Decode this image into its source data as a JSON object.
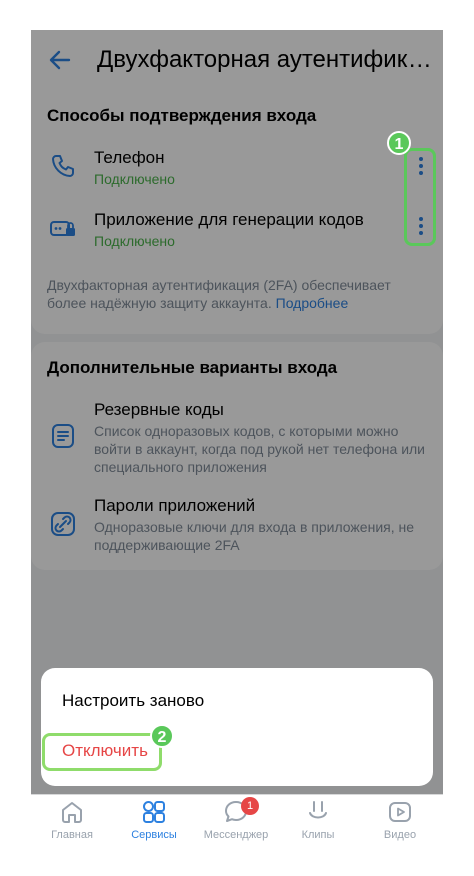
{
  "header": {
    "title": "Двухфакторная аутентификация"
  },
  "confirm_methods": {
    "title": "Способы подтверждения входа",
    "items": [
      {
        "title": "Телефон",
        "status": "Подключено"
      },
      {
        "title": "Приложение для генерации кодов",
        "status": "Подключено"
      }
    ],
    "info_text": "Двухфакторная аутентификация (2FA) обеспечивает более надёжную защиту аккаунта.",
    "info_link": "Подробнее"
  },
  "extra_methods": {
    "title": "Дополнительные варианты входа",
    "items": [
      {
        "title": "Резервные коды",
        "desc": "Список одноразовых кодов, с которыми можно войти в аккаунт, когда под рукой нет телефона или специального приложения"
      },
      {
        "title": "Пароли приложений",
        "desc": "Одноразовые ключи для входа в приложения, не поддерживающие 2FA"
      }
    ]
  },
  "sheet": {
    "reset_label": "Настроить заново",
    "disable_label": "Отключить"
  },
  "badges": {
    "one": "1",
    "two": "2"
  },
  "tabbar": {
    "tabs": [
      {
        "label": "Главная"
      },
      {
        "label": "Сервисы"
      },
      {
        "label": "Мессенджер",
        "count": "1"
      },
      {
        "label": "Клипы"
      },
      {
        "label": "Видео"
      }
    ]
  },
  "colors": {
    "accent": "#2d81e0",
    "success": "#4bb34b",
    "danger": "#e64646",
    "highlight": "#5ac85a"
  }
}
